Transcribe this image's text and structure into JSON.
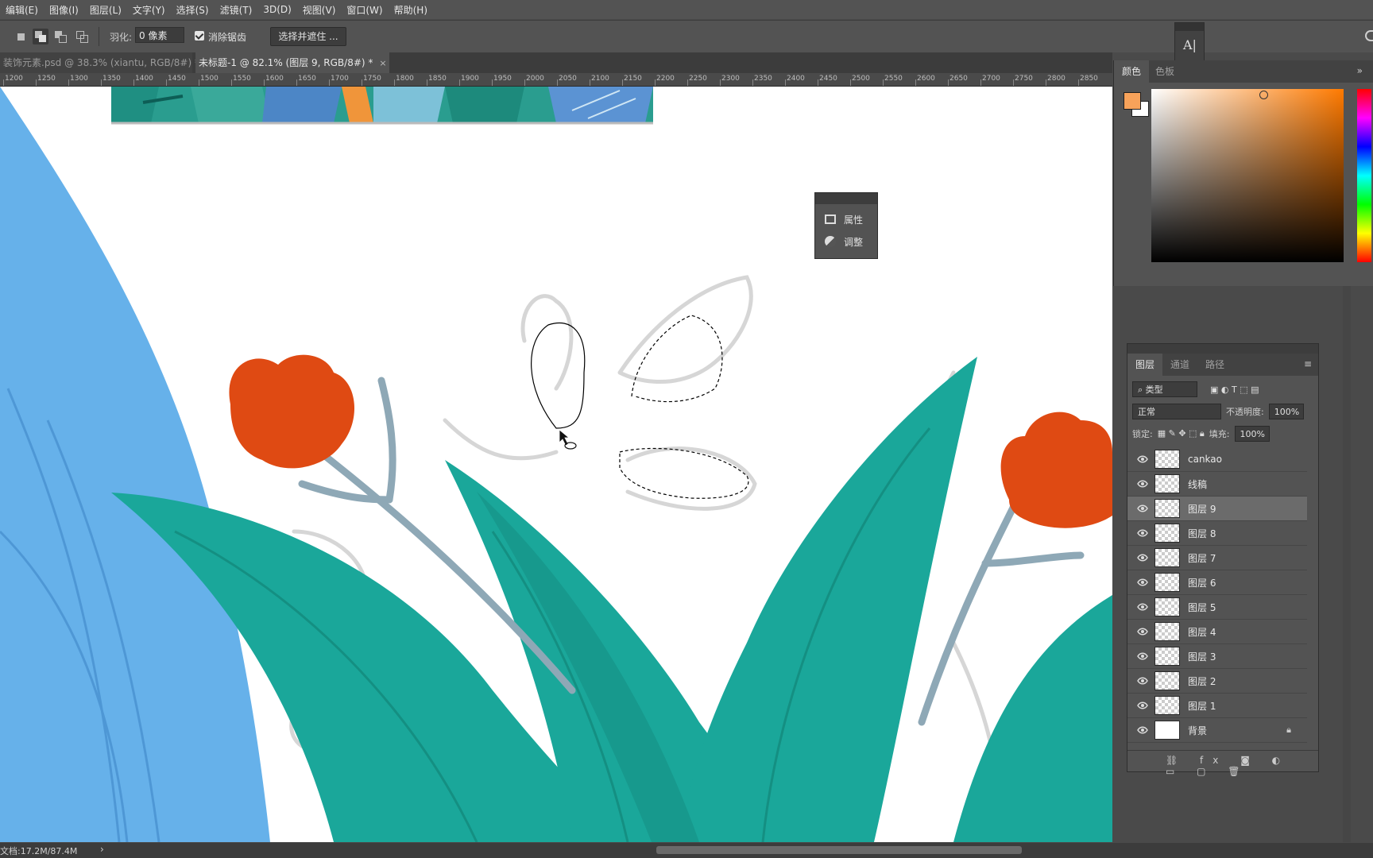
{
  "menu": [
    "编辑(E)",
    "图像(I)",
    "图层(L)",
    "文字(Y)",
    "选择(S)",
    "滤镜(T)",
    "3D(D)",
    "视图(V)",
    "窗口(W)",
    "帮助(H)"
  ],
  "options": {
    "feather_label": "羽化:",
    "feather_value": "0 像素",
    "antialias_label": "消除锯齿",
    "antialias_checked": true,
    "select_mask_button": "选择并遮住 ..."
  },
  "tabs": [
    {
      "label": "装饰元素.psd @ 38.3% (xiantu, RGB/8#) *",
      "close": "×",
      "active": false
    },
    {
      "label": "未标题-1 @ 82.1% (图层 9, RGB/8#) *",
      "close": "×",
      "active": true
    }
  ],
  "ruler": [
    "1200",
    "1250",
    "1300",
    "1350",
    "1400",
    "1450",
    "1500",
    "1550",
    "1600",
    "1650",
    "1700",
    "1750",
    "1800",
    "1850",
    "1900",
    "1950",
    "2000",
    "2050",
    "2100",
    "2150",
    "2200",
    "2250",
    "2300",
    "2350",
    "2400",
    "2450",
    "2500",
    "2550",
    "2600",
    "2650",
    "2700",
    "2750",
    "2800",
    "2850"
  ],
  "props_panel": {
    "properties": "属性",
    "adjustments": "调整"
  },
  "color_panel": {
    "tab_color": "颜色",
    "tab_swatches": "色板",
    "fg_color": "#f7a25a",
    "bg_color": "#ffffff"
  },
  "layers_panel": {
    "tab_layers": "图层",
    "tab_channels": "通道",
    "tab_paths": "路径",
    "filter_kind": "类型",
    "blend_mode": "正常",
    "opacity_label": "不透明度:",
    "opacity_value": "100%",
    "lock_label": "锁定:",
    "fill_label": "填充:",
    "fill_value": "100%",
    "layers": [
      {
        "name": "cankao",
        "selected": false
      },
      {
        "name": "线稿",
        "selected": false
      },
      {
        "name": "图层 9",
        "selected": true
      },
      {
        "name": "图层 8",
        "selected": false
      },
      {
        "name": "图层 7",
        "selected": false
      },
      {
        "name": "图层 6",
        "selected": false
      },
      {
        "name": "图层 5",
        "selected": false
      },
      {
        "name": "图层 4",
        "selected": false
      },
      {
        "name": "图层 3",
        "selected": false
      },
      {
        "name": "图层 2",
        "selected": false
      },
      {
        "name": "图层 1",
        "selected": false
      },
      {
        "name": "背景",
        "selected": false,
        "locked": true
      }
    ]
  },
  "status": {
    "doc_info": "文档:17.2M/87.4M"
  }
}
